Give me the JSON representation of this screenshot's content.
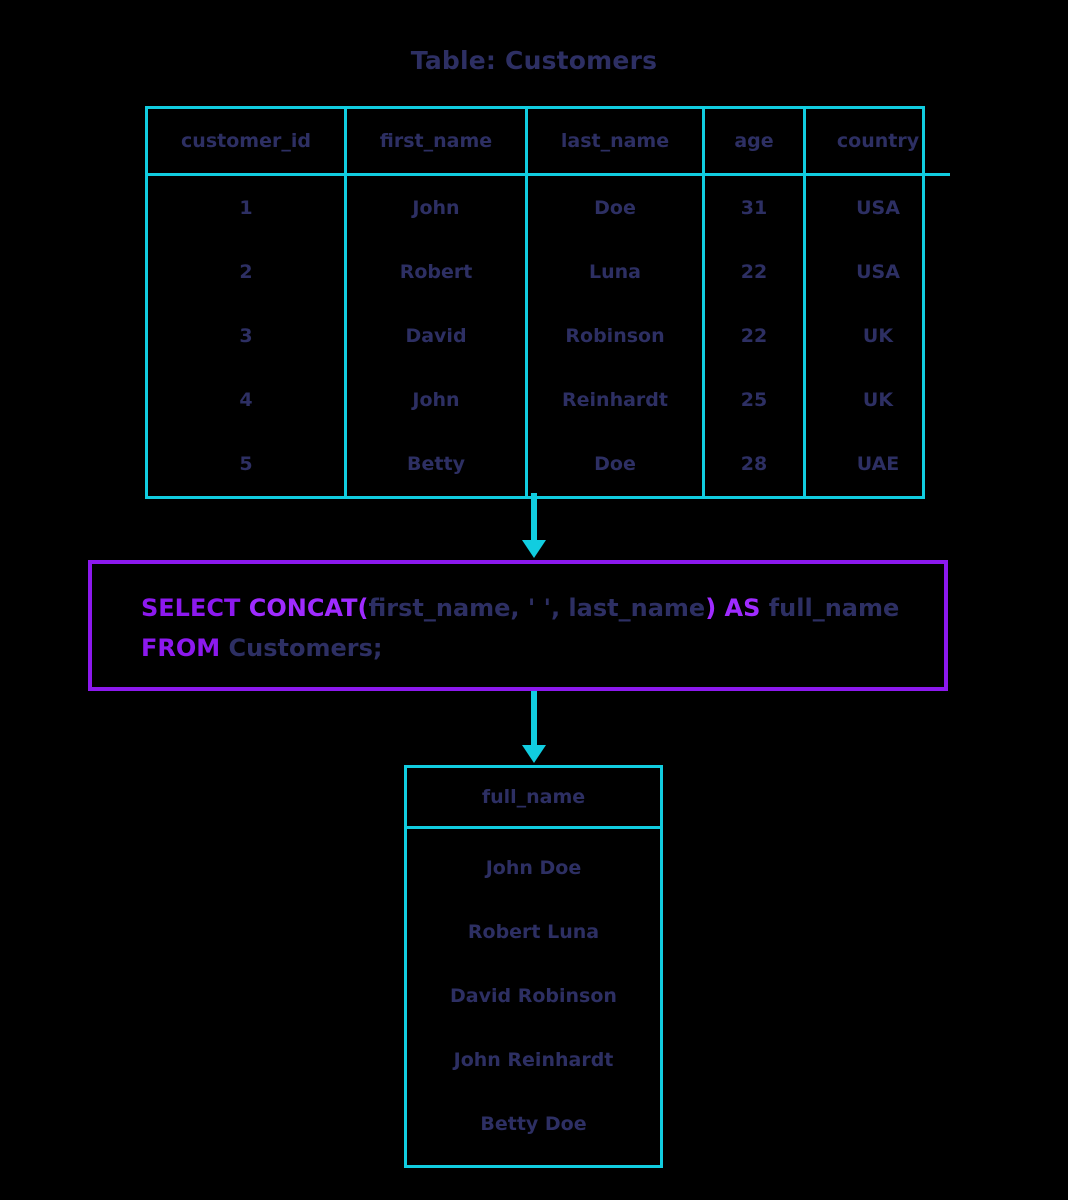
{
  "title": "Table: Customers",
  "colors": {
    "table_border": "#11cde0",
    "sql_box_border": "#8c19ee",
    "keyword": "#8c19ee",
    "function": "#9f2bff",
    "identifier": "#2d2f63",
    "arrow": "#11cde0",
    "background": "#000000"
  },
  "source_table": {
    "columns": [
      "customer_id",
      "first_name",
      "last_name",
      "age",
      "country"
    ],
    "rows": [
      [
        "1",
        "John",
        "Doe",
        "31",
        "USA"
      ],
      [
        "2",
        "Robert",
        "Luna",
        "22",
        "USA"
      ],
      [
        "3",
        "David",
        "Robinson",
        "22",
        "UK"
      ],
      [
        "4",
        "John",
        "Reinhardt",
        "25",
        "UK"
      ],
      [
        "5",
        "Betty",
        "Doe",
        "28",
        "UAE"
      ]
    ]
  },
  "sql": {
    "line1": {
      "select": "SELECT ",
      "concat_open": "CONCAT(",
      "args": "first_name, ' ', last_name",
      "paren_close": ")",
      "as": " AS ",
      "alias": "full_name"
    },
    "line2": {
      "from": "FROM ",
      "table": "Customers;"
    },
    "full_text": "SELECT CONCAT(first_name, ' ', last_name) AS full_name FROM Customers;"
  },
  "result_table": {
    "columns": [
      "full_name"
    ],
    "rows": [
      [
        "John Doe"
      ],
      [
        "Robert Luna"
      ],
      [
        "David Robinson"
      ],
      [
        "John Reinhardt"
      ],
      [
        "Betty Doe"
      ]
    ]
  },
  "arrows": {
    "top": "arrow-down",
    "bottom": "arrow-down"
  }
}
